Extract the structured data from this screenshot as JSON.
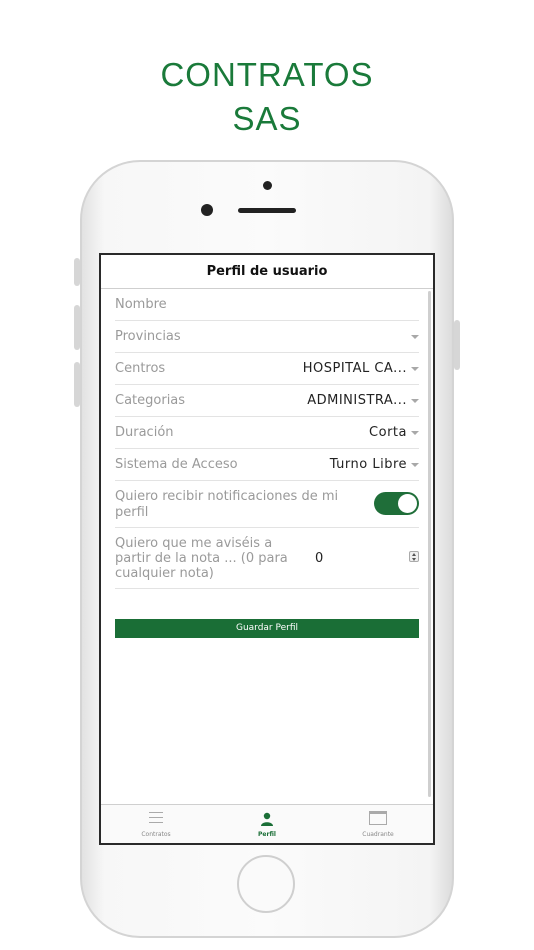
{
  "headline": {
    "line1": "CONTRATOS",
    "line2": "SAS"
  },
  "colors": {
    "brand_green": "#1a7a3a",
    "button_green": "#1a6e36",
    "toggle_green": "#1f6e39"
  },
  "screen": {
    "title": "Perfil de usuario",
    "fields": {
      "nombre": {
        "label": "Nombre",
        "value": ""
      },
      "provincias": {
        "label": "Provincias",
        "value": ""
      },
      "centros": {
        "label": "Centros",
        "value": "HOSPITAL CA..."
      },
      "categorias": {
        "label": "Categorias",
        "value": "ADMINISTRA..."
      },
      "duracion": {
        "label": "Duración",
        "value": "Corta"
      },
      "sistema": {
        "label": "Sistema de Acceso",
        "value": "Turno Libre"
      },
      "notificaciones": {
        "label": "Quiero recibir notificaciones de mi perfil",
        "enabled": true
      },
      "nota": {
        "label": "Quiero que me aviséis a partir de la nota ... (0 para cualquier nota)",
        "value": "0"
      }
    },
    "save_button": "Guardar Perfil",
    "tabs": [
      {
        "label": "Contratos",
        "icon": "list-icon"
      },
      {
        "label": "Perfil",
        "icon": "person-icon",
        "active": true
      },
      {
        "label": "Cuadrante",
        "icon": "calendar-icon"
      }
    ]
  }
}
